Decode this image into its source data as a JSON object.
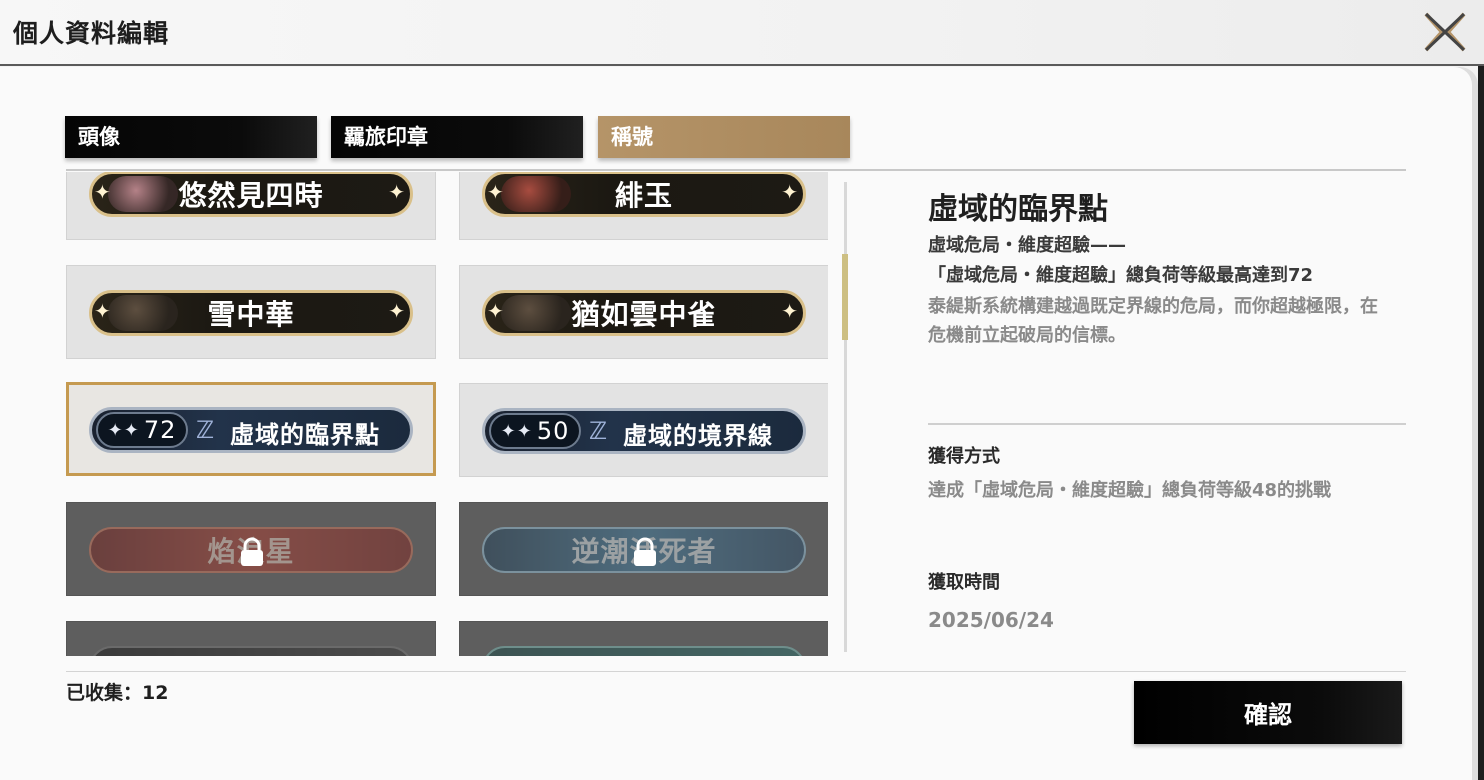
{
  "window": {
    "title": "個人資料編輯"
  },
  "tabs": [
    {
      "label": "頭像"
    },
    {
      "label": "羈旅印章"
    },
    {
      "label": "稱號"
    }
  ],
  "titles": [
    {
      "name": "悠然見四時",
      "state": "unlocked"
    },
    {
      "name": "緋玉",
      "state": "unlocked"
    },
    {
      "name": "雪中華",
      "state": "unlocked"
    },
    {
      "name": "猶如雲中雀",
      "state": "unlocked"
    },
    {
      "name": "虛域的臨界點",
      "level": "72",
      "state": "selected"
    },
    {
      "name": "虛域的境界線",
      "level": "50",
      "state": "unlocked"
    },
    {
      "name": "焰浪星",
      "state": "locked"
    },
    {
      "name": "逆潮活死者",
      "state": "locked"
    }
  ],
  "detail": {
    "title": "虛域的臨界點",
    "subtitle1": "虛域危局・維度超驗——",
    "subtitle2": "「虛域危局・維度超驗」總負荷等級最高達到72",
    "description": "泰緹斯系統構建越過既定界線的危局，而你超越極限，在危機前立起破局的信標。",
    "method_label": "獲得方式",
    "method_value": "達成「虛域危局・維度超驗」總負荷等級48的挑戰",
    "time_label": "獲取時間",
    "time_value": "2025/06/24"
  },
  "footer": {
    "collected": "已收集：12",
    "confirm_label": "確認"
  },
  "colors": {
    "active_tab": "#a8875b",
    "selected_border": "#c59a50",
    "scroll_thumb": "#cdbf82"
  }
}
